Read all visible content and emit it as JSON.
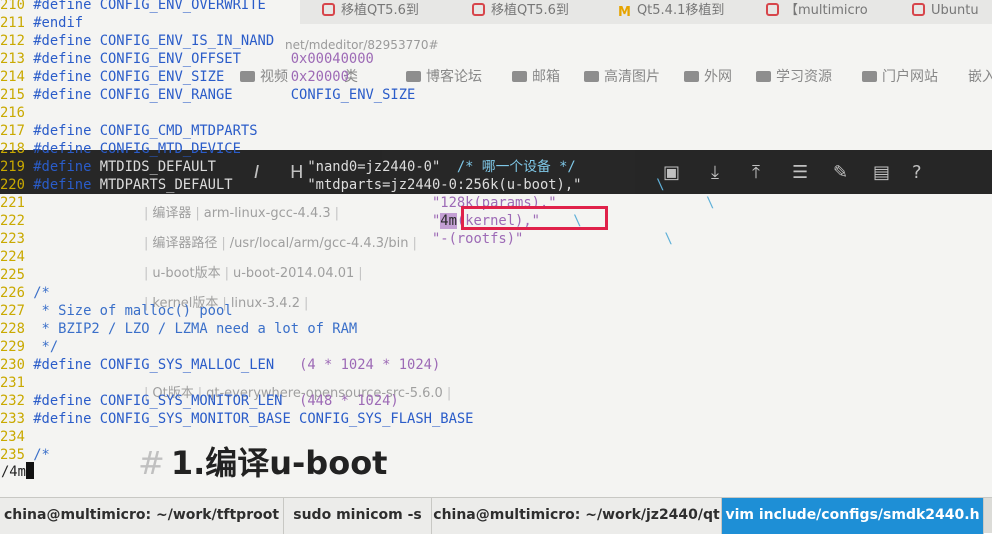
{
  "browser_background": {
    "tabs": [
      {
        "label": "移植QT5.6到",
        "icon": "csdn-icon"
      },
      {
        "label": "移植QT5.6到",
        "icon": "csdn-icon"
      },
      {
        "label": "Qt5.4.1移植到",
        "icon": "mail-m-icon"
      },
      {
        "label": "【multimicro",
        "icon": "csdn-icon"
      },
      {
        "label": "Ubuntu",
        "icon": "csdn-icon"
      }
    ],
    "url_fragment": "net/mdeditor/82953770#",
    "bookmarks": [
      "视频",
      "类",
      "博客论坛",
      "邮箱",
      "高清图片",
      "外网",
      "学习资源",
      "门户网站",
      "嵌入"
    ],
    "meta_rows": [
      {
        "label": "编译器",
        "value": "arm-linux-gcc-4.4.3"
      },
      {
        "label": "编译器路径",
        "value": "/usr/local/arm/gcc-4.4.3/bin"
      },
      {
        "label": "u-boot版本",
        "value": "u-boot-2014.04.01"
      },
      {
        "label": "kernel版本",
        "value": "linux-3.4.2"
      },
      {
        "label": "Qt版本",
        "value": "qt-everywhere-opensource-src-5.6.0"
      }
    ],
    "heading_hash": "#",
    "heading": "1.编译u-boot"
  },
  "terminal": {
    "lines": [
      {
        "n": "210",
        "pp": "#define",
        "rest": " CONFIG_ENV_OVERWRITE"
      },
      {
        "n": "211",
        "pp": "#endif",
        "rest": ""
      },
      {
        "n": "212",
        "pp": "#define",
        "rest": " CONFIG_ENV_IS_IN_NAND"
      },
      {
        "n": "213",
        "pp": "#define",
        "rest": " CONFIG_ENV_OFFSET      ",
        "num": "0x00040000"
      },
      {
        "n": "214",
        "pp": "#define",
        "rest": " CONFIG_ENV_SIZE        ",
        "num": "0x20000"
      },
      {
        "n": "215",
        "pp": "#define",
        "rest": " CONFIG_ENV_RANGE       CONFIG_ENV_SIZE"
      },
      {
        "n": "216",
        "pp": "",
        "rest": ""
      },
      {
        "n": "217",
        "pp": "#define",
        "rest": " CONFIG_CMD_MTDPARTS"
      },
      {
        "n": "218",
        "pp": "#define",
        "rest": " CONFIG_MTD_DEVICE"
      },
      {
        "n": "219",
        "pp": "#define",
        "rest": " MTDIDS_DEFAULT           ",
        "str": "\"nand0=jz2440-0\"",
        "cmt": "  /* 哪一个设备 */"
      },
      {
        "n": "220",
        "pp": "#define",
        "rest": " MTDPARTS_DEFAULT         ",
        "str": "\"mtdparts=jz2440-0:256k(u-boot),\"",
        "bs": "         \\"
      },
      {
        "n": "221",
        "pp": "",
        "rest": "                                                ",
        "str": "\"128k(params),\"",
        "bs": "                  \\"
      },
      {
        "n": "222",
        "pp": "",
        "rest": "                                                ",
        "str_pre": "\"",
        "hit": "4m",
        "str": "(kernel),\"",
        "bs": "    \\"
      },
      {
        "n": "223",
        "pp": "",
        "rest": "                                                ",
        "str": "\"-(rootfs)\"",
        "bs": "                 \\"
      },
      {
        "n": "224",
        "pp": "",
        "rest": ""
      },
      {
        "n": "225",
        "pp": "",
        "rest": ""
      },
      {
        "n": "226",
        "pp": "",
        "cmtline": "/*"
      },
      {
        "n": "227",
        "pp": "",
        "cmtline": " * Size of malloc() pool"
      },
      {
        "n": "228",
        "pp": "",
        "cmtline": " * BZIP2 / LZO / LZMA need a lot of RAM"
      },
      {
        "n": "229",
        "pp": "",
        "cmtline": " */"
      },
      {
        "n": "230",
        "pp": "#define",
        "rest": " CONFIG_SYS_MALLOC_LEN   ",
        "num": "(4 * 1024 * 1024)"
      },
      {
        "n": "231",
        "pp": "",
        "rest": ""
      },
      {
        "n": "232",
        "pp": "#define",
        "rest": " CONFIG_SYS_MONITOR_LEN  ",
        "num": "(448 * 1024)"
      },
      {
        "n": "233",
        "pp": "#define",
        "rest": " CONFIG_SYS_MONITOR_BASE CONFIG_SYS_FLASH_BASE"
      },
      {
        "n": "234",
        "pp": "",
        "rest": ""
      },
      {
        "n": "235",
        "pp": "",
        "cmtline": "/*"
      }
    ],
    "command_line": "/4m"
  },
  "terminal_tabs": [
    {
      "label": "china@multimicro: ~/work/tftproot",
      "active": false
    },
    {
      "label": "sudo minicom -s",
      "active": false
    },
    {
      "label": "china@multimicro: ~/work/jz2440/qt",
      "active": false
    },
    {
      "label": "vim include/configs/smdk2440.h",
      "active": true
    }
  ]
}
